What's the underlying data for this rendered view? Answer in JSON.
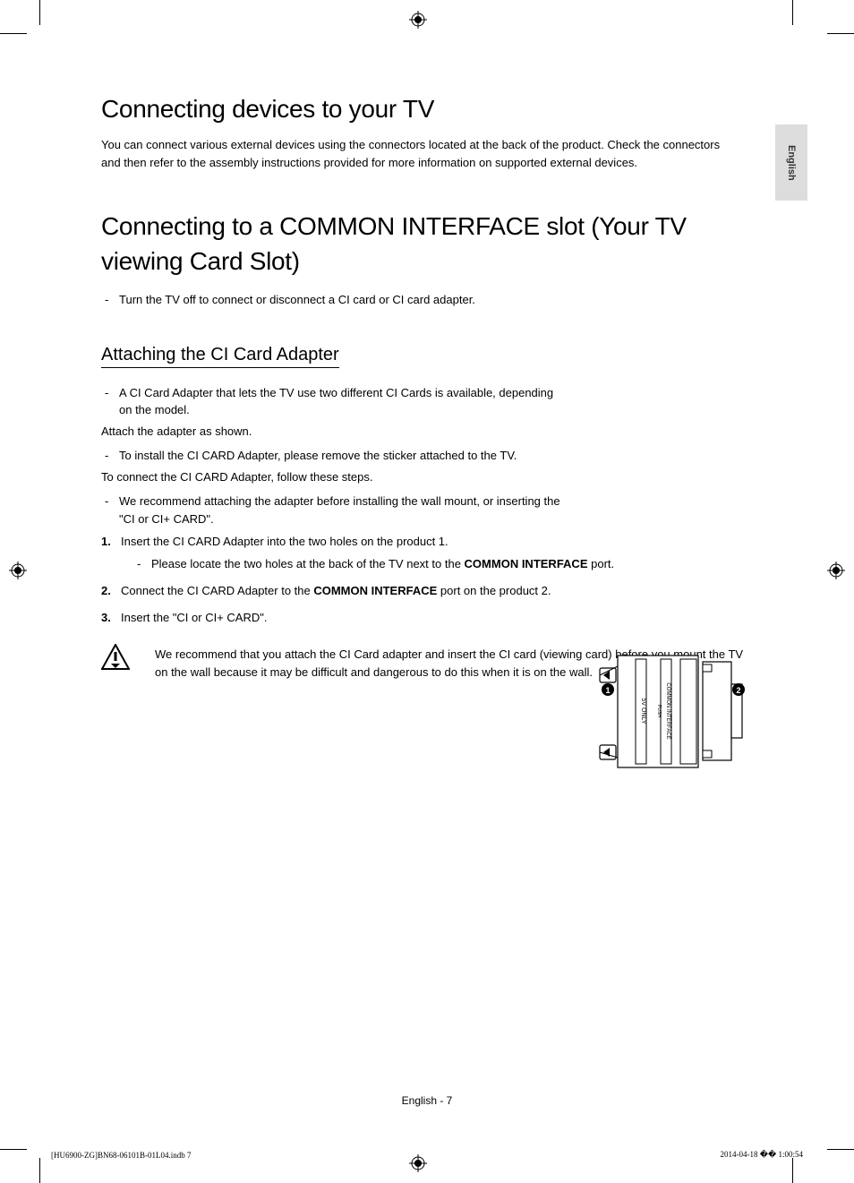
{
  "langTab": "English",
  "heading1": "Connecting devices to your TV",
  "intro1": "You can connect various external devices using the connectors located at the back of the product. Check the connectors and then refer to the assembly instructions provided for more information on supported external devices.",
  "heading2": "Connecting to a COMMON INTERFACE slot (Your TV viewing Card Slot)",
  "bullet_h2_1": "Turn the TV off to connect or disconnect a CI card or CI card adapter.",
  "sub1": "Attaching the CI Card Adapter",
  "sub1_b1": "A CI Card Adapter that lets the TV use two different CI Cards is available, depending on the model.",
  "sub1_p1": "Attach the adapter as shown.",
  "sub1_b2": "To install the CI CARD Adapter, please remove the sticker attached to the TV.",
  "sub1_p2": "To connect the CI CARD Adapter, follow these steps.",
  "sub1_b3": "We recommend attaching the adapter before installing the wall mount, or inserting the \"CI or CI+ CARD\".",
  "step1": "Insert the CI CARD Adapter into the two holes on the product 1.",
  "step1_sub_pre": "Please locate the two holes at the back of the TV next to the ",
  "step1_sub_bold": "COMMON INTERFACE",
  "step1_sub_post": " port.",
  "step2_pre": "Connect the CI CARD Adapter to the ",
  "step2_bold": "COMMON INTERFACE",
  "step2_post": " port on the product 2.",
  "step3": "Insert the \"CI or CI+ CARD\".",
  "warning": "We recommend that you attach the CI Card adapter and insert the CI card (viewing card) before you mount the TV on the wall because it may be difficult and dangerous to do this when it is on the wall.",
  "diagram_label_ci": "COMMON INTERFACE",
  "diagram_label_5v": "5V ONLY",
  "diagram_label_push": "PUSH",
  "pageNum": "English - 7",
  "footLeft": "[HU6900-ZG]BN68-06101B-01L04.indb   7",
  "footRight": "2014-04-18   �� 1:00:54"
}
